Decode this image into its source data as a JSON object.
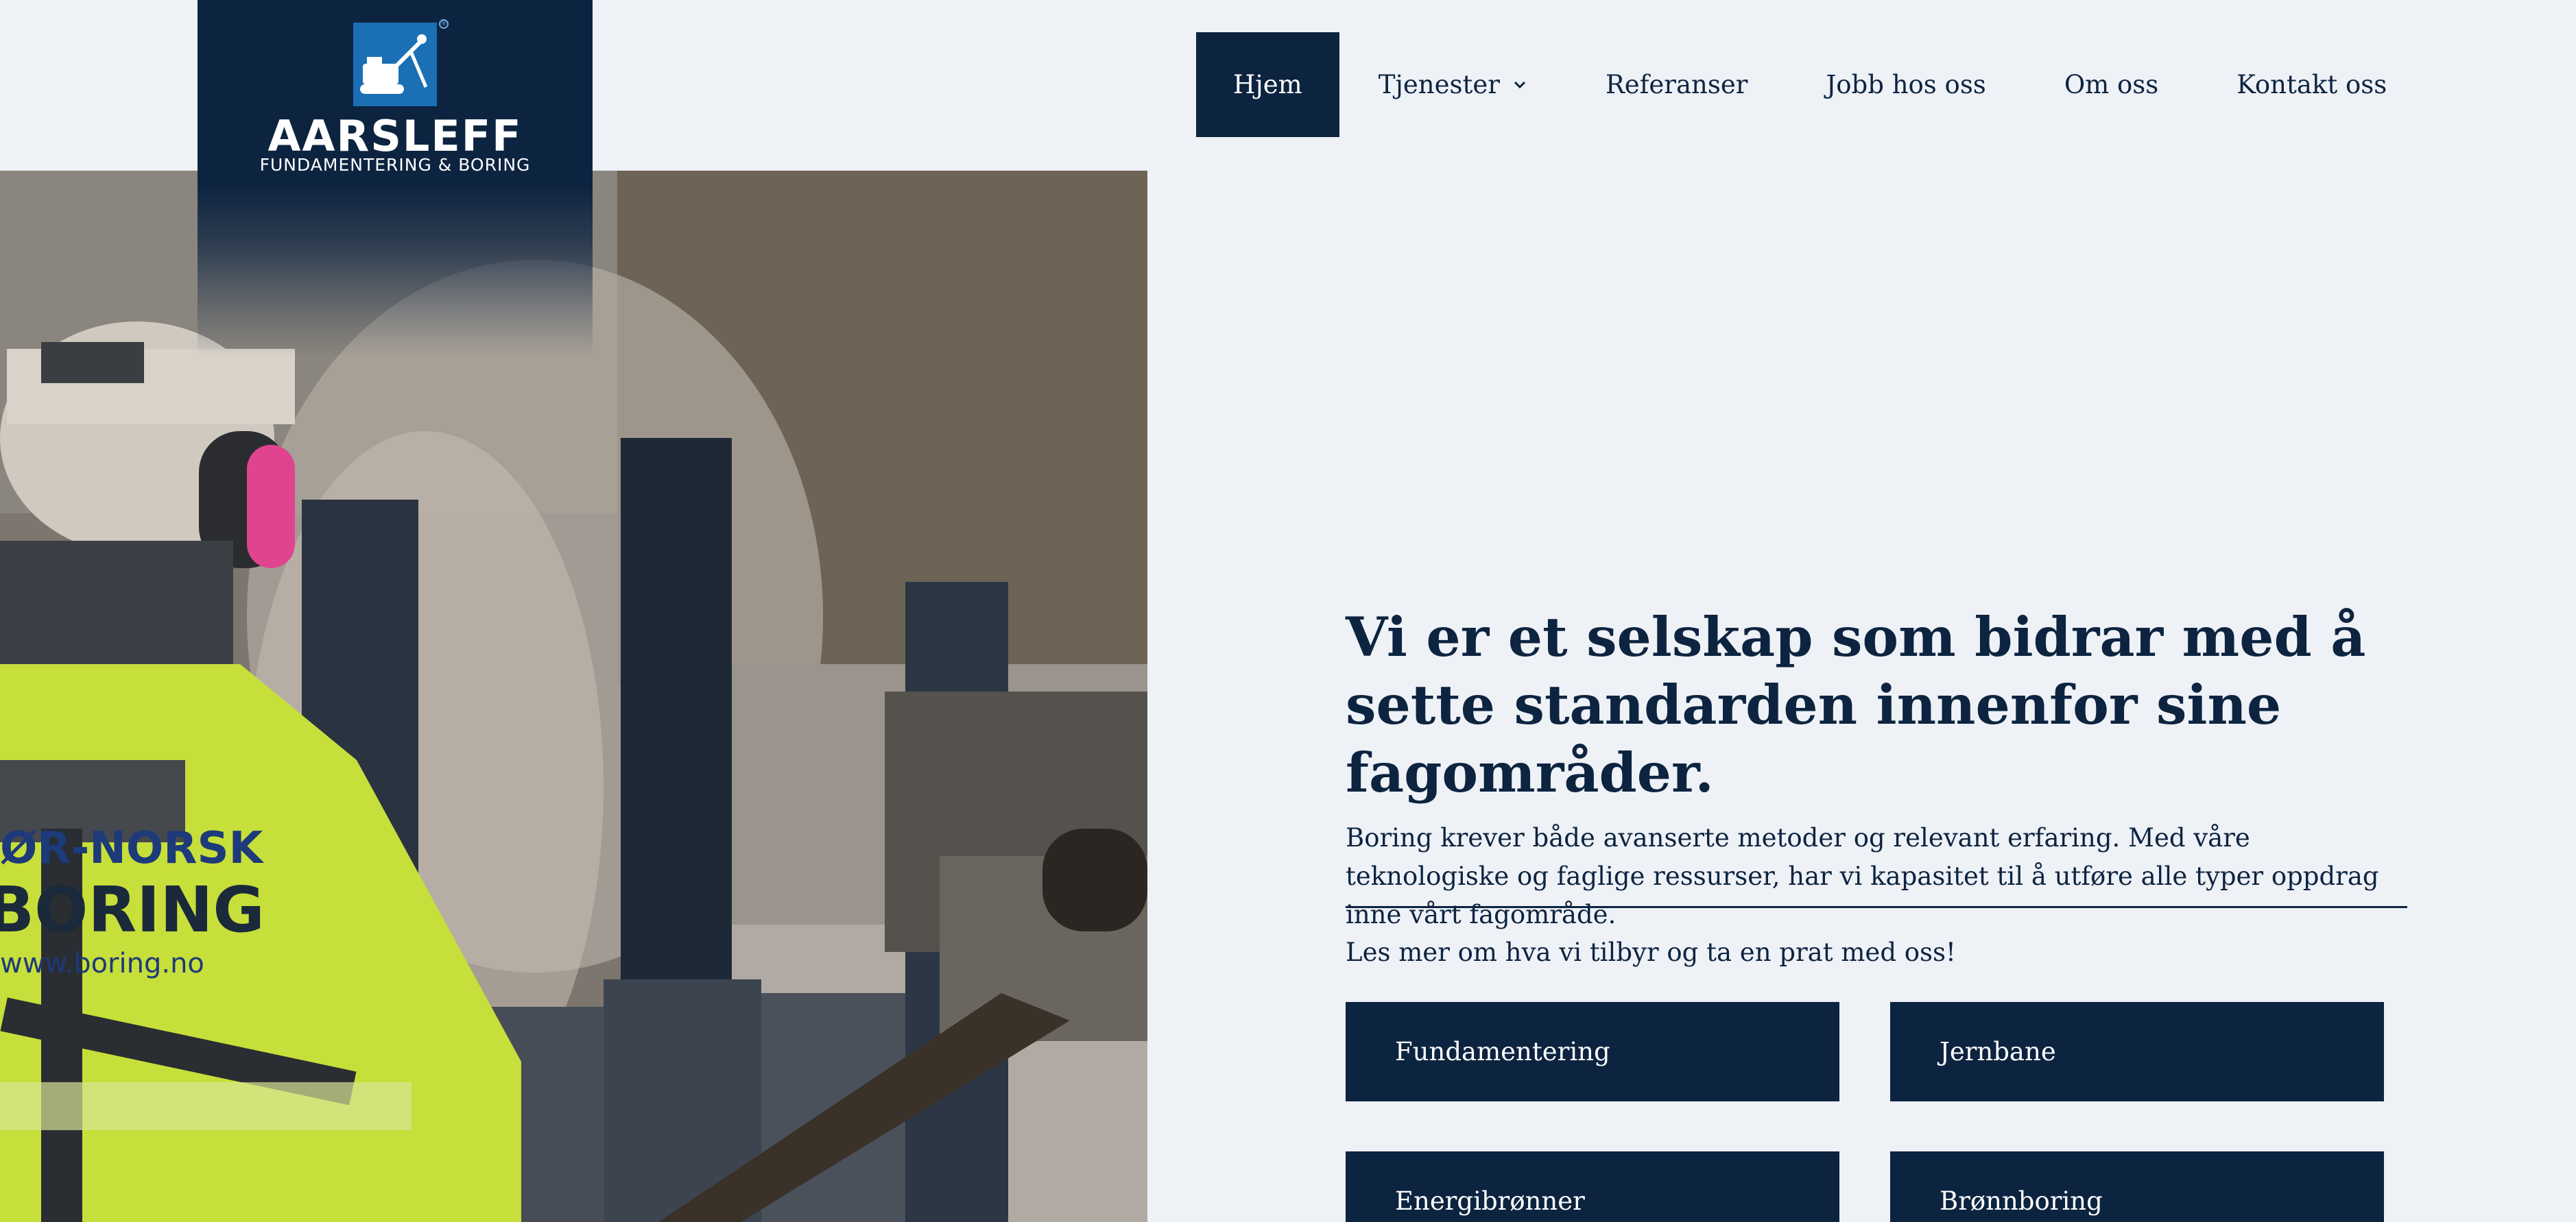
{
  "brand": {
    "name": "AARSLEFF",
    "tagline": "FUNDAMENTERING & BORING",
    "registered_mark": "®",
    "primary_color": "#0d2440",
    "logo_color": "#1a6fb5",
    "logo_icon": "excavator-drill-icon"
  },
  "nav": {
    "items": [
      {
        "label": "Hjem",
        "active": true
      },
      {
        "label": "Tjenester",
        "has_dropdown": true
      },
      {
        "label": "Referanser"
      },
      {
        "label": "Jobb hos oss"
      },
      {
        "label": "Om oss"
      },
      {
        "label": "Kontakt oss"
      }
    ]
  },
  "hero": {
    "headline": "Vi er et selskap som bidrar med å sette standarden innenfor sine fagområder.",
    "lead": "Boring krever både avanserte metoder og relevant erfaring. Med våre teknologiske og faglige ressurser, har vi kapasitet til å utføre alle typer oppdrag inne vårt fagområde.",
    "cta": "Les mer om hva vi tilbyr og ta en prat med oss!"
  },
  "photo": {
    "jacket_text_line1": "ØR-NORSK",
    "jacket_text_line2": "BORING",
    "jacket_text_line3": "www.boring.no"
  },
  "services": [
    {
      "label": "Fundamentering"
    },
    {
      "label": "Jernbane"
    },
    {
      "label": "Energibrønner"
    },
    {
      "label": "Brønnboring"
    }
  ]
}
